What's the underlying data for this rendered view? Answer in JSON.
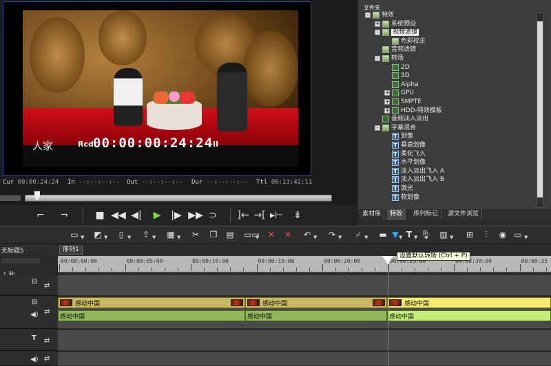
{
  "preview": {
    "caption": "人家",
    "timecode_prefix": "Rcd",
    "timecode": "00:00:00:24:24",
    "pause_glyph": "II",
    "status": [
      {
        "key": "Cur",
        "value": "00:00:24:24"
      },
      {
        "key": "In",
        "value": "--:--:--:--"
      },
      {
        "key": "Out",
        "value": "--:--:--:--"
      },
      {
        "key": "Dur",
        "value": "--:--:--:--"
      },
      {
        "key": "Ttl",
        "value": "00:13:42:11"
      }
    ],
    "scrub_position": 0.04
  },
  "effects": {
    "title": "文件夹",
    "tree": [
      {
        "label": "特效",
        "indent": 0,
        "expander": "-",
        "icon": "folder-icon"
      },
      {
        "label": "系统预设",
        "indent": 1,
        "expander": "+",
        "icon": "folder-icon"
      },
      {
        "label": "视频滤镜",
        "indent": 1,
        "expander": "-",
        "icon": "folder-icon",
        "selected": true
      },
      {
        "label": "色彩校正",
        "indent": 2,
        "expander": "",
        "icon": "folder-icon"
      },
      {
        "label": "音频滤镜",
        "indent": 1,
        "expander": "",
        "icon": "folder-icon"
      },
      {
        "label": "转场",
        "indent": 1,
        "expander": "-",
        "icon": "folder-icon"
      },
      {
        "label": "2D",
        "indent": 2,
        "expander": "",
        "icon": "effect-icon"
      },
      {
        "label": "3D",
        "indent": 2,
        "expander": "",
        "icon": "effect-icon"
      },
      {
        "label": "Alpha",
        "indent": 2,
        "expander": "",
        "icon": "effect-icon"
      },
      {
        "label": "GPU",
        "indent": 2,
        "expander": "+",
        "icon": "effect-icon"
      },
      {
        "label": "SMPTE",
        "indent": 2,
        "expander": "+",
        "icon": "effect-icon"
      },
      {
        "label": "HDD-特效模板",
        "indent": 2,
        "expander": "+",
        "icon": "effect-icon"
      },
      {
        "label": "音频淡入淡出",
        "indent": 1,
        "expander": "",
        "icon": "effect-icon"
      },
      {
        "label": "字幕混合",
        "indent": 1,
        "expander": "-",
        "icon": "folder-icon"
      },
      {
        "label": "划像",
        "indent": 2,
        "expander": "",
        "icon": "title-icon"
      },
      {
        "label": "垂直划像",
        "indent": 2,
        "expander": "",
        "icon": "title-icon"
      },
      {
        "label": "柔化飞入",
        "indent": 2,
        "expander": "",
        "icon": "title-icon"
      },
      {
        "label": "水平划像",
        "indent": 2,
        "expander": "",
        "icon": "title-icon"
      },
      {
        "label": "淡入淡出飞入 A",
        "indent": 2,
        "expander": "",
        "icon": "title-icon"
      },
      {
        "label": "淡入淡出飞入 B",
        "indent": 2,
        "expander": "",
        "icon": "title-icon"
      },
      {
        "label": "激光",
        "indent": 2,
        "expander": "",
        "icon": "title-icon"
      },
      {
        "label": "软划像",
        "indent": 2,
        "expander": "",
        "icon": "title-icon"
      }
    ],
    "tabs": [
      {
        "label": "素材库",
        "active": false
      },
      {
        "label": "特效",
        "active": true
      },
      {
        "label": "序列标记",
        "active": false
      },
      {
        "label": "源文件浏览",
        "active": false
      }
    ]
  },
  "timeline": {
    "sequence_name": "无标题5",
    "sequence_tab": "序列1",
    "scale": "1 秒",
    "ruler": [
      "00:00:00:00",
      "00:00:05:00",
      "00:00:10:00",
      "00:00:15:00",
      "00:00:20:00",
      "00:00:25:00",
      "00:00:30:00",
      "00:00:35"
    ],
    "tooltip": "设置默认转场 (Ctrl + P)",
    "video_clips": [
      "感动中国",
      "感动中国",
      "感动中国"
    ],
    "audio_clips": [
      "感动中国",
      "感动中国",
      "感动中国"
    ]
  }
}
